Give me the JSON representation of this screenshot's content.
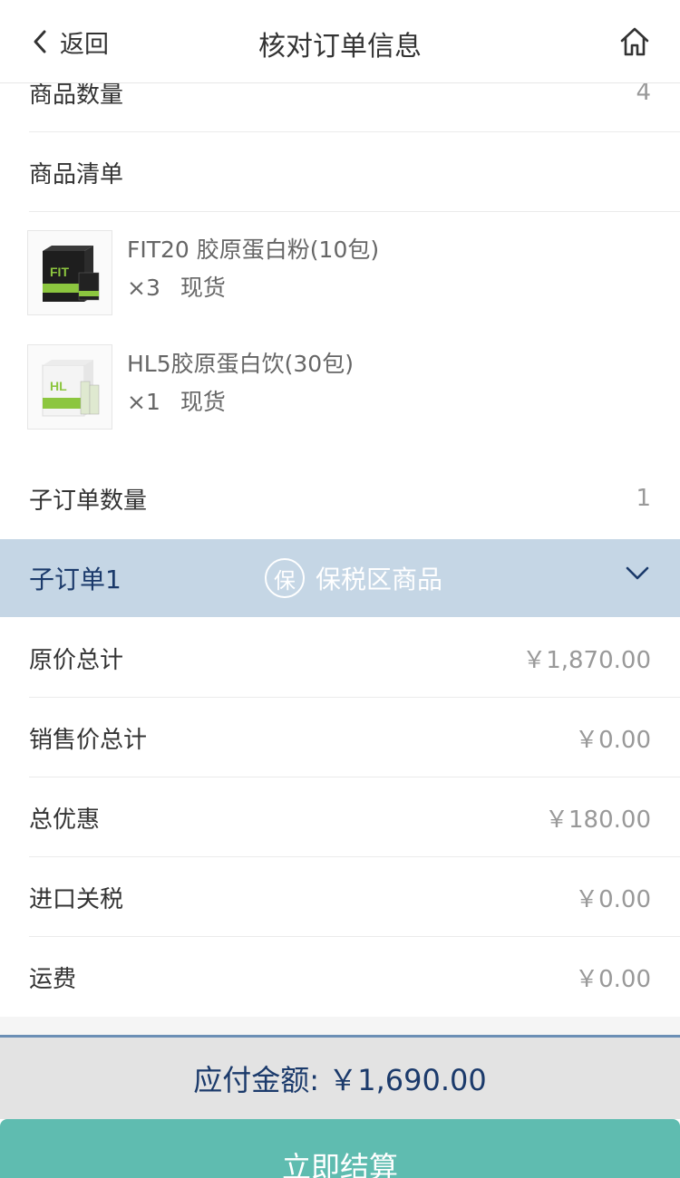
{
  "header": {
    "back_label": "返回",
    "title": "核对订单信息",
    "home_icon": "home-icon"
  },
  "summary": {
    "product_count_label": "商品数量",
    "product_count_value": "4",
    "product_list_label": "商品清单"
  },
  "products": [
    {
      "name": "FIT20 胶原蛋白粉(10包)",
      "qty": "×3",
      "stock": "现货"
    },
    {
      "name": "HL5胶原蛋白饮(30包)",
      "qty": "×1",
      "stock": "现货"
    }
  ],
  "suborders": {
    "count_label": "子订单数量",
    "count_value": "1",
    "first": {
      "title": "子订单1",
      "badge": "保",
      "type": "保税区商品"
    }
  },
  "costs": [
    {
      "label": "原价总计",
      "value": "￥1,870.00"
    },
    {
      "label": "销售价总计",
      "value": "￥0.00"
    },
    {
      "label": "总优惠",
      "value": "￥180.00"
    },
    {
      "label": "进口关税",
      "value": "￥0.00"
    },
    {
      "label": "运费",
      "value": "￥0.00"
    }
  ],
  "footer": {
    "payable_label": "应付金额: ￥1,690.00",
    "checkout_label": "立即结算"
  },
  "colors": {
    "accent_bar": "#c5d6e5",
    "checkout": "#5fbcb0",
    "navy": "#1b3a6b"
  }
}
